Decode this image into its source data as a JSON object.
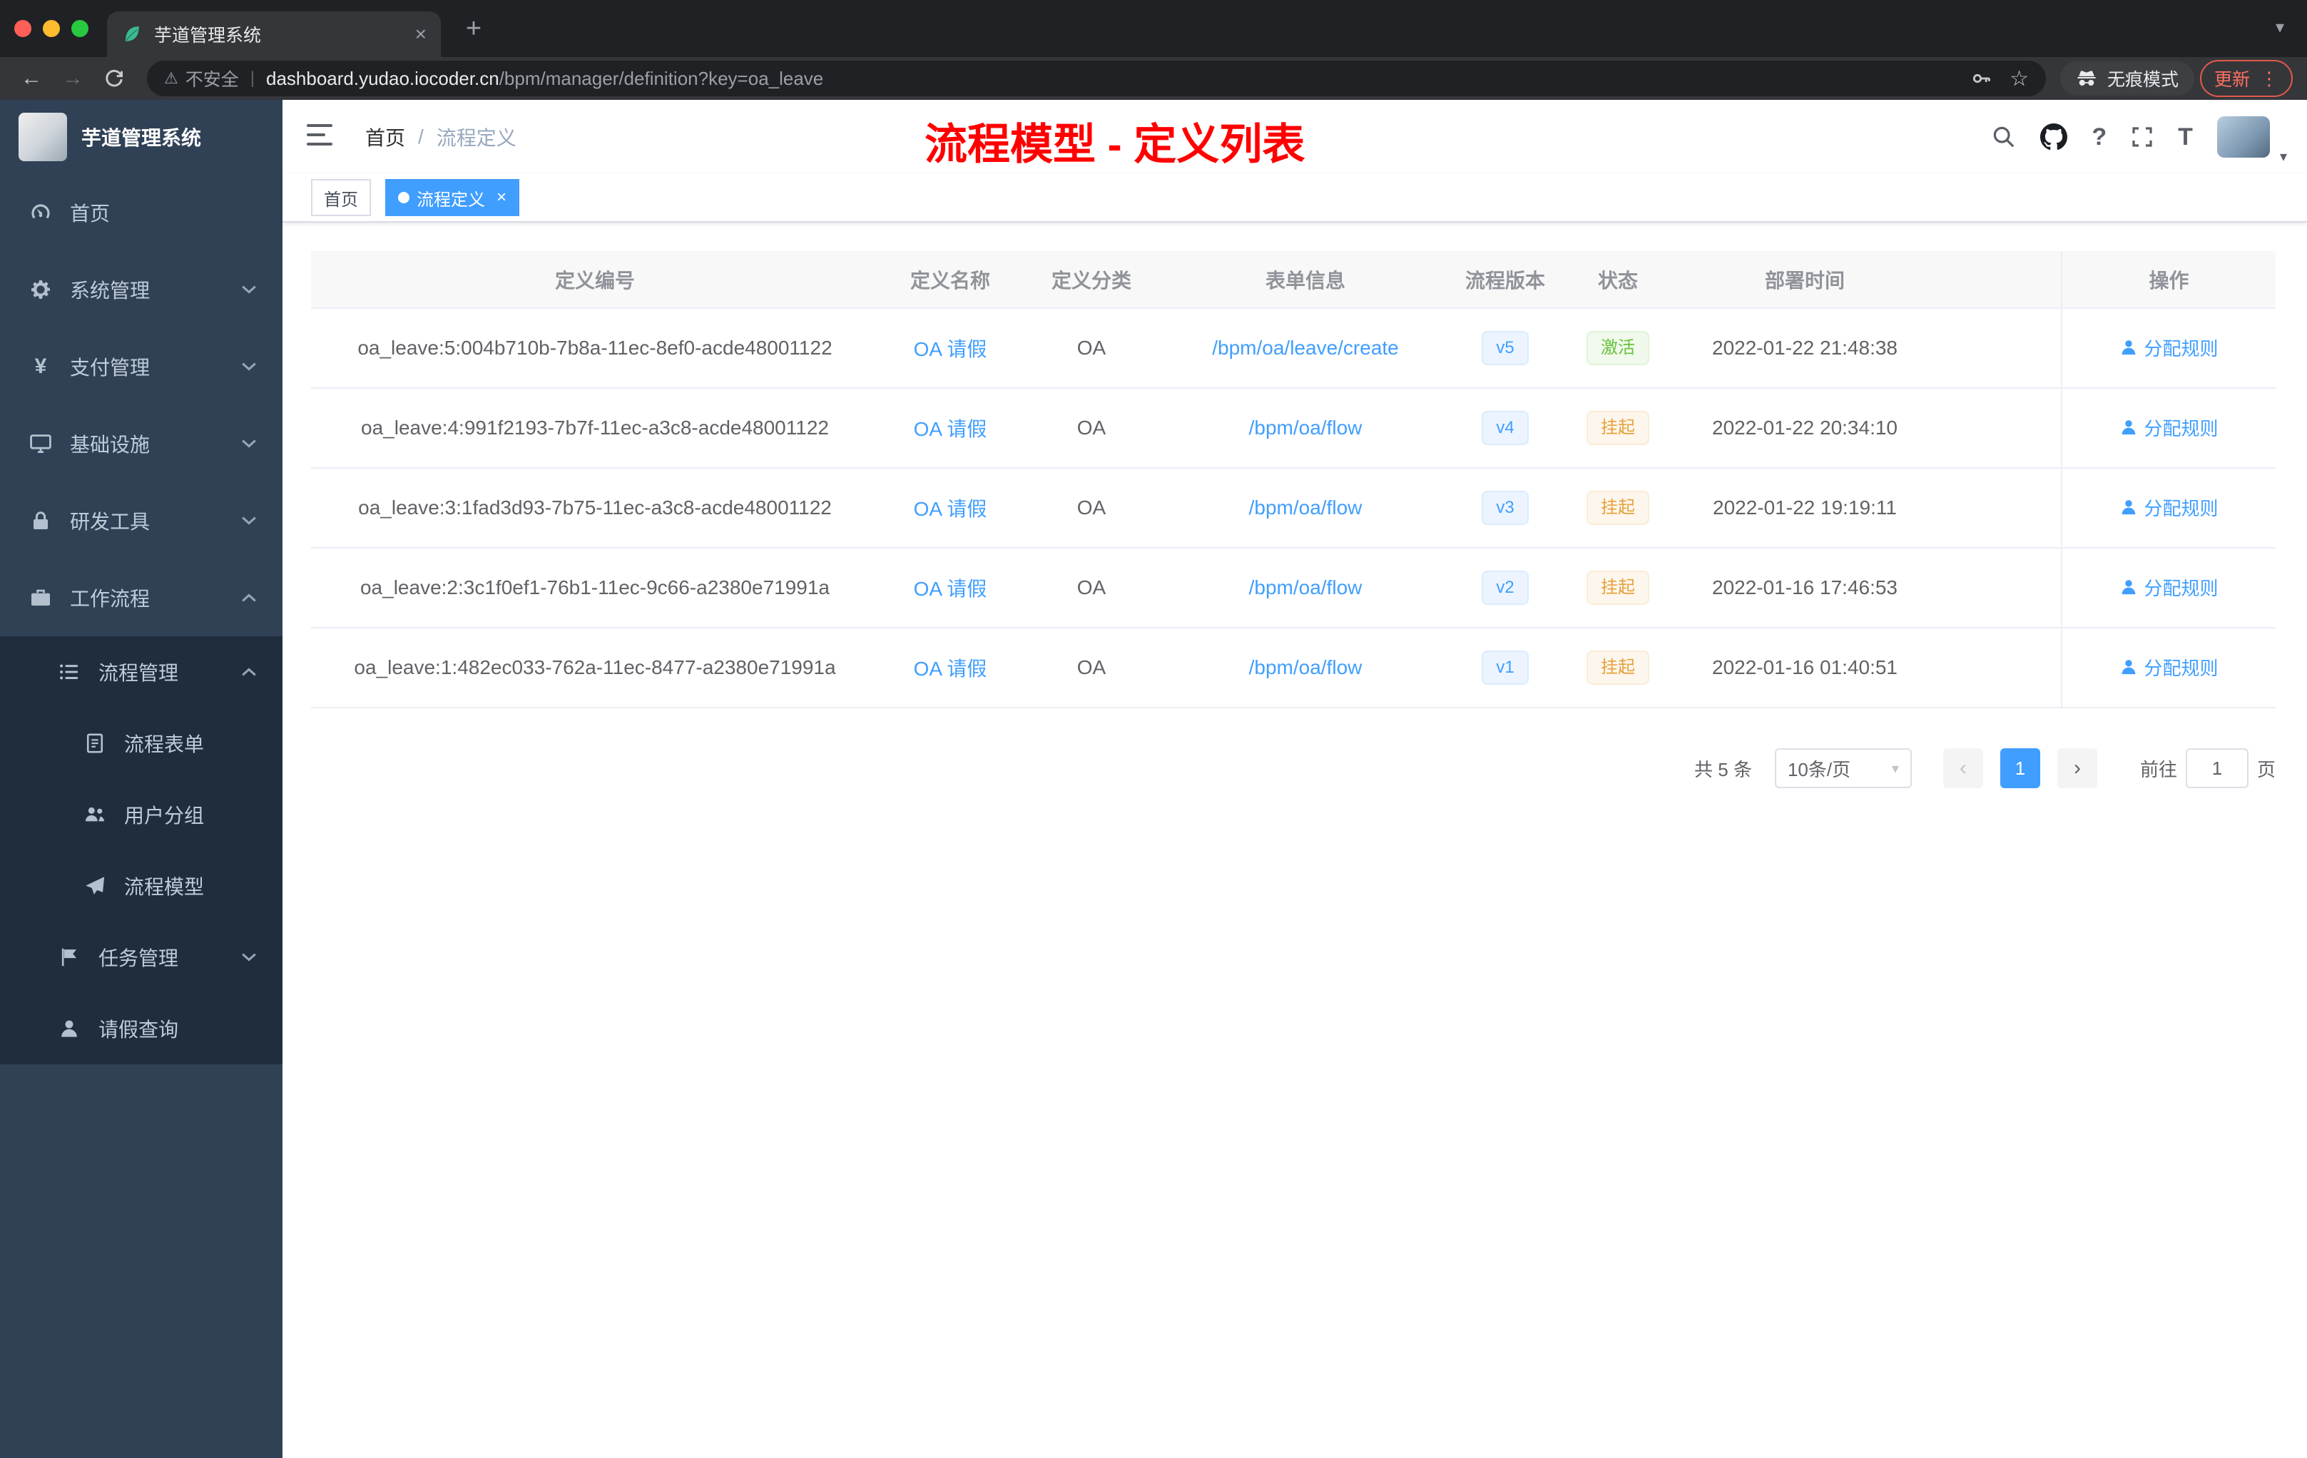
{
  "browser": {
    "tab_title": "芋道管理系统",
    "close_glyph": "×",
    "new_tab_glyph": "+",
    "back_glyph": "←",
    "forward_glyph": "→",
    "security_label": "不安全",
    "url_host": "dashboard.yudao.iocoder.cn",
    "url_path": "/bpm/manager/definition?key=oa_leave",
    "star_glyph": "☆",
    "warning_glyph": "⚠",
    "incognito_label": "无痕模式",
    "update_label": "更新",
    "menu_glyph": "⋮",
    "tabsearch_glyph": "▾"
  },
  "sidebar": {
    "logo_title": "芋道管理系统",
    "items": [
      {
        "label": "首页"
      },
      {
        "label": "系统管理"
      },
      {
        "label": "支付管理"
      },
      {
        "label": "基础设施"
      },
      {
        "label": "研发工具"
      },
      {
        "label": "工作流程"
      },
      {
        "label": "流程管理"
      },
      {
        "label": "流程表单"
      },
      {
        "label": "用户分组"
      },
      {
        "label": "流程模型"
      },
      {
        "label": "任务管理"
      },
      {
        "label": "请假查询"
      }
    ]
  },
  "navbar": {
    "breadcrumb_home": "首页",
    "breadcrumb_separator": "/",
    "breadcrumb_current": "流程定义",
    "annotation": "流程模型 - 定义列表",
    "help_glyph": "?",
    "fontsize_glyph": "T",
    "avatar_caret_glyph": "▾"
  },
  "tags": {
    "home": "首页",
    "active": "流程定义",
    "close_glyph": "×"
  },
  "table": {
    "columns": [
      "定义编号",
      "定义名称",
      "定义分类",
      "表单信息",
      "流程版本",
      "状态",
      "部署时间",
      "操作"
    ],
    "rows": [
      {
        "id": "oa_leave:5:004b710b-7b8a-11ec-8ef0-acde48001122",
        "name": "OA 请假",
        "category": "OA",
        "form": "/bpm/oa/leave/create",
        "version": "v5",
        "status": "激活",
        "status_type": "success",
        "time": "2022-01-22 21:48:38",
        "action": "分配规则"
      },
      {
        "id": "oa_leave:4:991f2193-7b7f-11ec-a3c8-acde48001122",
        "name": "OA 请假",
        "category": "OA",
        "form": "/bpm/oa/flow",
        "version": "v4",
        "status": "挂起",
        "status_type": "warning",
        "time": "2022-01-22 20:34:10",
        "action": "分配规则"
      },
      {
        "id": "oa_leave:3:1fad3d93-7b75-11ec-a3c8-acde48001122",
        "name": "OA 请假",
        "category": "OA",
        "form": "/bpm/oa/flow",
        "version": "v3",
        "status": "挂起",
        "status_type": "warning",
        "time": "2022-01-22 19:19:11",
        "action": "分配规则"
      },
      {
        "id": "oa_leave:2:3c1f0ef1-76b1-11ec-9c66-a2380e71991a",
        "name": "OA 请假",
        "category": "OA",
        "form": "/bpm/oa/flow",
        "version": "v2",
        "status": "挂起",
        "status_type": "warning",
        "time": "2022-01-16 17:46:53",
        "action": "分配规则"
      },
      {
        "id": "oa_leave:1:482ec033-762a-11ec-8477-a2380e71991a",
        "name": "OA 请假",
        "category": "OA",
        "form": "/bpm/oa/flow",
        "version": "v1",
        "status": "挂起",
        "status_type": "warning",
        "time": "2022-01-16 01:40:51",
        "action": "分配规则"
      }
    ]
  },
  "pagination": {
    "total": "共 5 条",
    "page_size": "10条/页",
    "size_caret_glyph": "▾",
    "prev_glyph": "‹",
    "next_glyph": "›",
    "current_page": "1",
    "goto_prefix": "前往",
    "goto_value": "1",
    "goto_suffix": "页"
  },
  "colors": {
    "accent": "#409eff",
    "sidebar_bg": "#304156",
    "submenu_bg": "#1f2d3d",
    "annotation_red": "#ff0000",
    "status_success": "#67c23a",
    "status_warning": "#e6a23c",
    "tab_active_bg": "#409eff"
  }
}
